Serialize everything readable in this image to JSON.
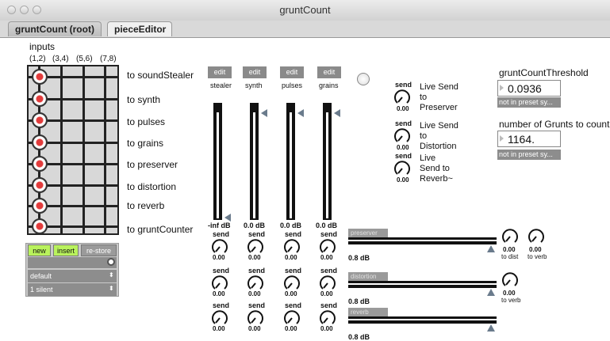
{
  "window": {
    "title": "gruntCount"
  },
  "tabs": [
    {
      "label": "gruntCount (root)"
    },
    {
      "label": "pieceEditor"
    }
  ],
  "matrix": {
    "title": "inputs",
    "columns": [
      "(1,2)",
      "(3,4)",
      "(5,6)",
      "(7,8)"
    ],
    "rows": [
      "to soundStealer",
      "to synth",
      "to pulses",
      "to grains",
      "to preserver",
      "to distortion",
      "to reverb",
      "to gruntCounter"
    ]
  },
  "preset": {
    "new": "new",
    "insert": "insert",
    "restore": "re-store",
    "menu1": "default",
    "menu2": "1 silent"
  },
  "channels": [
    {
      "edit": "edit",
      "name": "stealer",
      "db": "-inf dB",
      "level": 0.0
    },
    {
      "edit": "edit",
      "name": "synth",
      "db": "0.0 dB",
      "level": 1.0
    },
    {
      "edit": "edit",
      "name": "pulses",
      "db": "0.0 dB",
      "level": 1.0
    },
    {
      "edit": "edit",
      "name": "grains",
      "db": "0.0 dB",
      "level": 1.0
    }
  ],
  "sends": {
    "label": "send",
    "value": "0.00"
  },
  "live_sends": [
    {
      "label": "send",
      "value": "0.00",
      "text1": "Live Send",
      "text2": "to",
      "text3": "Preserver"
    },
    {
      "label": "send",
      "value": "0.00",
      "text1": "Live Send",
      "text2": "to",
      "text3": "Distortion"
    },
    {
      "label": "send",
      "value": "0.00",
      "text1": "Live",
      "text2": "Send to",
      "text3": "Reverb~"
    }
  ],
  "threshold": {
    "title": "gruntCountThreshold",
    "value": "0.0936",
    "preset_note": "not in preset sy..."
  },
  "grunts": {
    "title": "number of Grunts to count",
    "value": "1164.",
    "preset_note": "not in preset sy..."
  },
  "effects": [
    {
      "name": "preserver",
      "db": "0.8 dB",
      "knobs": [
        {
          "value": "0.00",
          "label": "to dist"
        },
        {
          "value": "0.00",
          "label": "to verb"
        }
      ]
    },
    {
      "name": "distortion",
      "db": "0.8 dB",
      "knobs": [
        {
          "value": "0.00",
          "label": "to verb"
        }
      ]
    },
    {
      "name": "reverb",
      "db": "0.8 dB",
      "knobs": []
    }
  ],
  "colors": {
    "green": "#b9f25c",
    "gray": "#8d8d8d"
  }
}
